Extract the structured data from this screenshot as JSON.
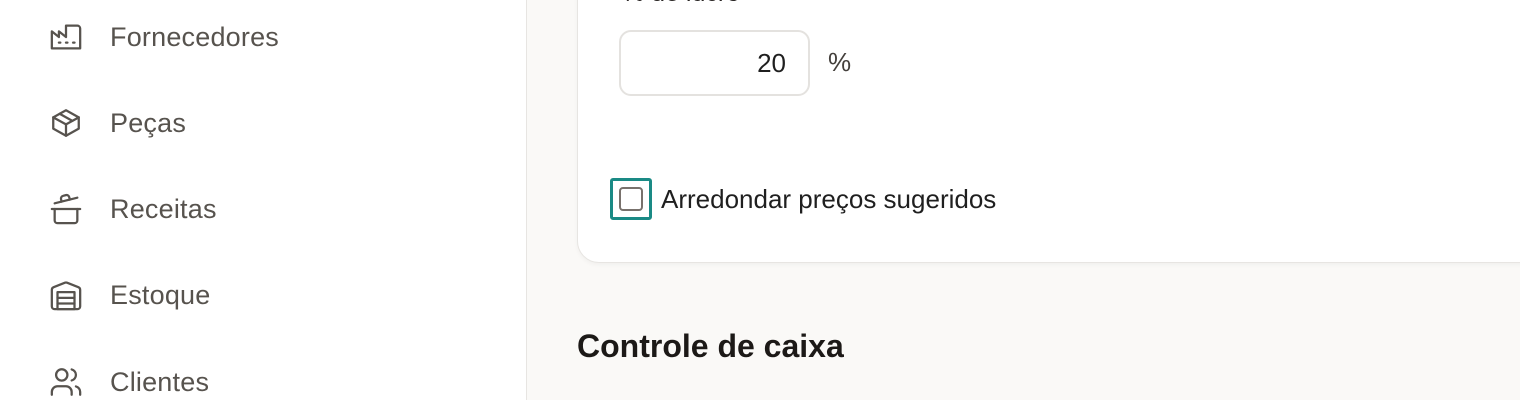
{
  "sidebar": {
    "items": [
      {
        "label": "Fornecedores",
        "icon": "factory-icon"
      },
      {
        "label": "Peças",
        "icon": "package-icon"
      },
      {
        "label": "Receitas",
        "icon": "cooking-pot-icon"
      },
      {
        "label": "Estoque",
        "icon": "warehouse-icon"
      },
      {
        "label": "Clientes",
        "icon": "users-icon"
      }
    ]
  },
  "pricing": {
    "profit_label": "% de lucro",
    "profit_value": "20",
    "profit_unit": "%",
    "round_label": "Arredondar preços sugeridos",
    "round_checked": false
  },
  "cash": {
    "title": "Controle de caixa"
  },
  "colors": {
    "accent": "#1a8a85",
    "text_muted": "#57534e",
    "background": "#faf9f7"
  }
}
